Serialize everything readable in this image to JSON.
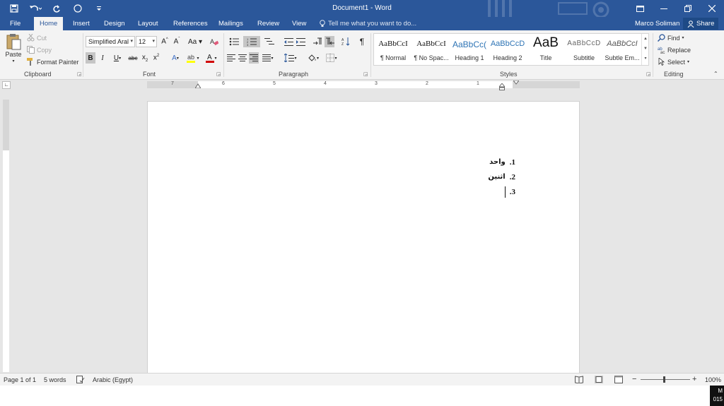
{
  "window": {
    "title": "Document1 - Word",
    "user": "Marco Soliman",
    "share_label": "Share"
  },
  "tabs": [
    "File",
    "Home",
    "Insert",
    "Design",
    "Layout",
    "References",
    "Mailings",
    "Review",
    "View"
  ],
  "active_tab": "Home",
  "tell_me_placeholder": "Tell me what you want to do...",
  "clipboard": {
    "paste": "Paste",
    "cut": "Cut",
    "copy": "Copy",
    "format_painter": "Format Painter",
    "group_label": "Clipboard"
  },
  "font": {
    "name": "Simplified Aral",
    "size": "12",
    "group_label": "Font"
  },
  "paragraph": {
    "group_label": "Paragraph"
  },
  "styles": {
    "group_label": "Styles",
    "items": [
      {
        "preview": "AaBbCcI",
        "name": "¶ Normal"
      },
      {
        "preview": "AaBbCcI",
        "name": "¶ No Spac..."
      },
      {
        "preview": "AaBbCc(",
        "name": "Heading 1"
      },
      {
        "preview": "AaBbCcD",
        "name": "Heading 2"
      },
      {
        "preview": "AaB",
        "name": "Title"
      },
      {
        "preview": "AaBbCcD",
        "name": "Subtitle"
      },
      {
        "preview": "AaBbCcI",
        "name": "Subtle Em..."
      }
    ]
  },
  "editing": {
    "find": "Find",
    "replace": "Replace",
    "select": "Select",
    "group_label": "Editing"
  },
  "ruler": {
    "numbers": [
      "7",
      "6",
      "5",
      "4",
      "3",
      "2",
      "1"
    ]
  },
  "document": {
    "list": [
      {
        "num": "1.",
        "text": "واحد"
      },
      {
        "num": "2.",
        "text": "اثنين"
      },
      {
        "num": "3.",
        "text": ""
      }
    ]
  },
  "status": {
    "page": "Page 1 of 1",
    "words": "5 words",
    "language": "Arabic (Egypt)",
    "zoom": "100%"
  },
  "taskbar_clock": {
    "line1": "M",
    "line2": "015"
  }
}
